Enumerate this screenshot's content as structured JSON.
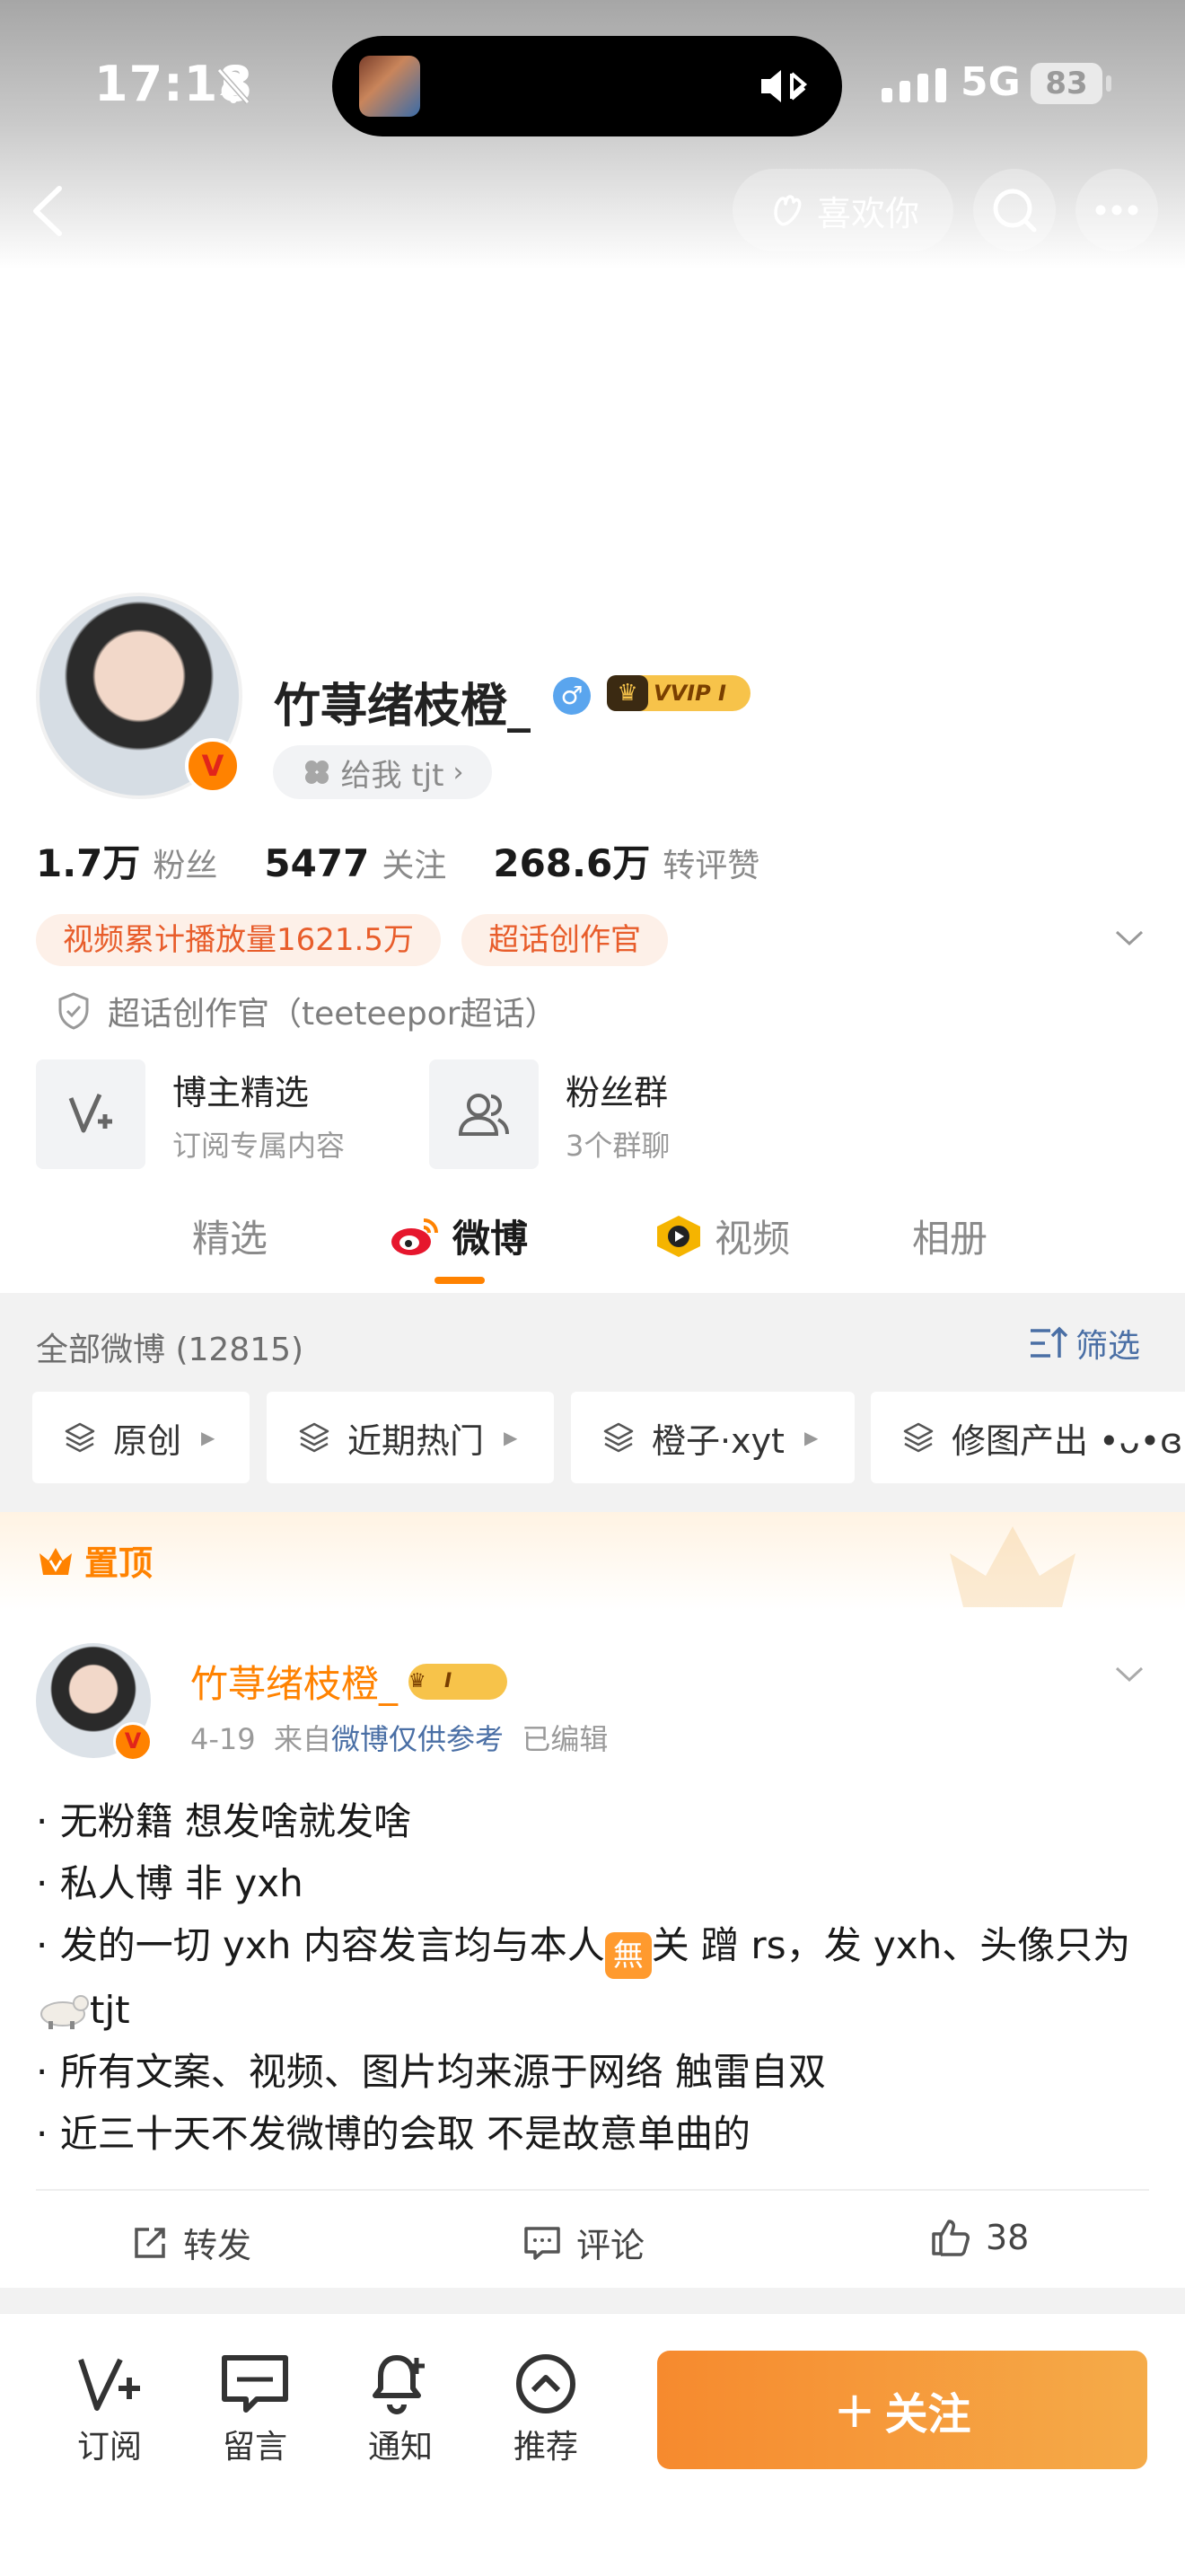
{
  "status_bar": {
    "time": "17:18",
    "network": "5G",
    "battery": "83"
  },
  "nav": {
    "like_label": "喜欢你"
  },
  "profile": {
    "name": "竹荨绪枝橙_",
    "gender_symbol": "♂",
    "vvip_label": "VVIP I",
    "verified_badge": "V",
    "tjt_label": "给我 tjt",
    "stats": [
      {
        "value": "1.7万",
        "label": "粉丝"
      },
      {
        "value": "5477",
        "label": "关注"
      },
      {
        "value": "268.6万",
        "label": "转评赞"
      }
    ],
    "tags": [
      "视频累计播放量1621.5万",
      "超话创作官"
    ],
    "super_topic": "超话创作官（teeteepor超话）",
    "cards": [
      {
        "title": "博主精选",
        "subtitle": "订阅专属内容"
      },
      {
        "title": "粉丝群",
        "subtitle": "3个群聊"
      }
    ]
  },
  "tabs": [
    "精选",
    "微博",
    "视频",
    "相册"
  ],
  "active_tab": "微博",
  "filter": {
    "all_count": "全部微博 (12815)",
    "filter_label": "筛选",
    "chips": [
      "原创",
      "近期热门",
      "橙子·xyt",
      "修图产出 •ᴗ•ɞ"
    ]
  },
  "pinned_label": "置顶",
  "post": {
    "author": "竹荨绪枝橙_",
    "vip_label": "I",
    "date": "4-19",
    "source_prefix": "来自",
    "source": "微博仅供参考",
    "edited": "已编辑",
    "lines": {
      "l1": "· 无粉籍  想发啥就发啥",
      "l2": "· 私人博 非 yxh",
      "l3a": "· 发的一切 yxh 内容发言均与本人",
      "l3_emoji": "無",
      "l3b": "关  蹭 rs，发 yxh、头像只为",
      "l3c": "tjt",
      "l4": "· 所有文案、视频、图片均来源于网络  触雷自双",
      "l5": "· 近三十天不发微博的会取  不是故意单曲的"
    },
    "actions": {
      "repost": "转发",
      "comment": "评论",
      "like_count": "38"
    }
  },
  "bottom_nav": {
    "subscribe": "订阅",
    "message": "留言",
    "notify": "通知",
    "recommend": "推荐",
    "follow": "关注"
  },
  "colors": {
    "accent": "#ff8200",
    "link": "#4a6fa5",
    "tag_text": "#e85d2b"
  }
}
